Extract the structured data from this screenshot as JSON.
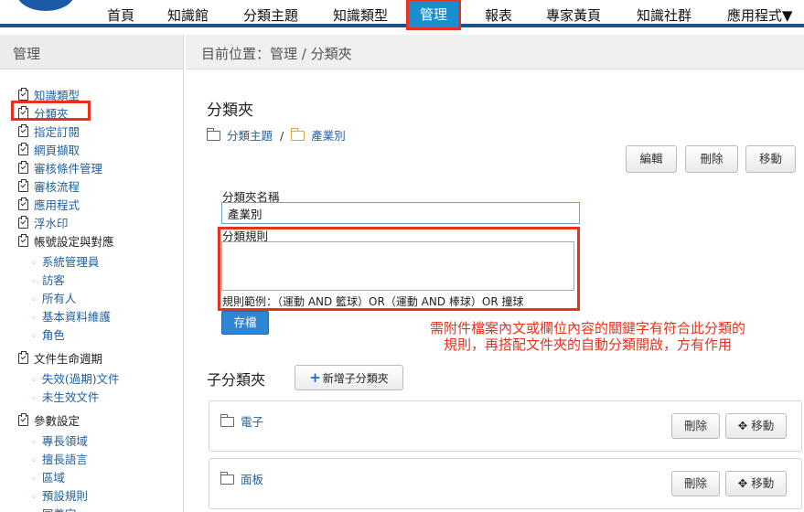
{
  "nav": {
    "items": [
      "首頁",
      "知識館",
      "分類主題",
      "知識類型",
      "管理",
      "報表",
      "專家黃頁",
      "知識社群",
      "應用程式▼"
    ]
  },
  "sidebar": {
    "header": "管理",
    "items": [
      "知識類型",
      "分類夾",
      "指定訂閱",
      "網頁擷取",
      "審核條件管理",
      "審核流程",
      "應用程式",
      "浮水印"
    ],
    "account_group": "帳號設定與對應",
    "account_items": [
      "系統管理員",
      "訪客",
      "所有人",
      "基本資料維護",
      "角色"
    ],
    "lifecycle_group": "文件生命週期",
    "lifecycle_items": [
      "失效(過期)文件",
      "未生效文件"
    ],
    "params_group": "參數設定",
    "params_items": [
      "專長領域",
      "擅長語言",
      "區域",
      "預設規則",
      "同義字"
    ]
  },
  "breadcrumb": "目前位置：管理 / 分類夾",
  "page": {
    "title": "分類夾",
    "path": [
      "分類主題",
      "產業別"
    ],
    "path_sep": "/",
    "edit_label": "編輯",
    "delete_label": "刪除",
    "move_label": "移動",
    "folder_name_label": "分類夾名稱",
    "folder_name_value": "產業別",
    "rule_label": "分類規則",
    "rule_value": "",
    "rule_example": "規則範例：（運動 AND 籃球）OR（運動 AND 棒球）OR 撞球",
    "save_label": "存檔",
    "annotation": "需附件檔案內文或欄位內容的關鍵字有符合此分類的規則，再搭配文件夾的自動分類開啟，方有作用"
  },
  "children": {
    "title": "子分類夾",
    "add_label": "新增子分類夾",
    "rows": [
      {
        "name": "電子",
        "delete_label": "刪除",
        "move_label": "移動"
      },
      {
        "name": "面板",
        "delete_label": "刪除",
        "move_label": "移動"
      }
    ]
  },
  "colors": {
    "accent": "#1a8fcf",
    "highlight": "#e8321e",
    "link": "#1f5f9e",
    "primary_button": "#2f86d6"
  }
}
